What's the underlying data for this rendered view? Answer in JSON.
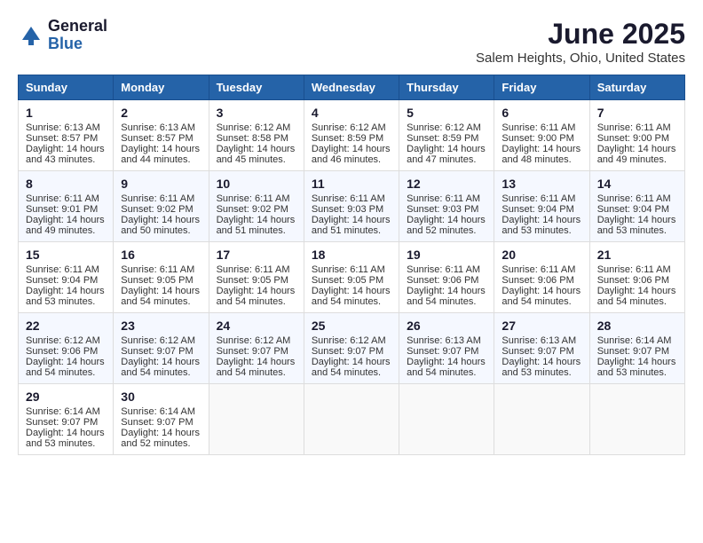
{
  "header": {
    "logo_general": "General",
    "logo_blue": "Blue",
    "month_title": "June 2025",
    "location": "Salem Heights, Ohio, United States"
  },
  "days_of_week": [
    "Sunday",
    "Monday",
    "Tuesday",
    "Wednesday",
    "Thursday",
    "Friday",
    "Saturday"
  ],
  "weeks": [
    [
      {
        "day": "1",
        "sunrise": "6:13 AM",
        "sunset": "8:57 PM",
        "daylight": "14 hours and 43 minutes."
      },
      {
        "day": "2",
        "sunrise": "6:13 AM",
        "sunset": "8:57 PM",
        "daylight": "14 hours and 44 minutes."
      },
      {
        "day": "3",
        "sunrise": "6:12 AM",
        "sunset": "8:58 PM",
        "daylight": "14 hours and 45 minutes."
      },
      {
        "day": "4",
        "sunrise": "6:12 AM",
        "sunset": "8:59 PM",
        "daylight": "14 hours and 46 minutes."
      },
      {
        "day": "5",
        "sunrise": "6:12 AM",
        "sunset": "8:59 PM",
        "daylight": "14 hours and 47 minutes."
      },
      {
        "day": "6",
        "sunrise": "6:11 AM",
        "sunset": "9:00 PM",
        "daylight": "14 hours and 48 minutes."
      },
      {
        "day": "7",
        "sunrise": "6:11 AM",
        "sunset": "9:00 PM",
        "daylight": "14 hours and 49 minutes."
      }
    ],
    [
      {
        "day": "8",
        "sunrise": "6:11 AM",
        "sunset": "9:01 PM",
        "daylight": "14 hours and 49 minutes."
      },
      {
        "day": "9",
        "sunrise": "6:11 AM",
        "sunset": "9:02 PM",
        "daylight": "14 hours and 50 minutes."
      },
      {
        "day": "10",
        "sunrise": "6:11 AM",
        "sunset": "9:02 PM",
        "daylight": "14 hours and 51 minutes."
      },
      {
        "day": "11",
        "sunrise": "6:11 AM",
        "sunset": "9:03 PM",
        "daylight": "14 hours and 51 minutes."
      },
      {
        "day": "12",
        "sunrise": "6:11 AM",
        "sunset": "9:03 PM",
        "daylight": "14 hours and 52 minutes."
      },
      {
        "day": "13",
        "sunrise": "6:11 AM",
        "sunset": "9:04 PM",
        "daylight": "14 hours and 53 minutes."
      },
      {
        "day": "14",
        "sunrise": "6:11 AM",
        "sunset": "9:04 PM",
        "daylight": "14 hours and 53 minutes."
      }
    ],
    [
      {
        "day": "15",
        "sunrise": "6:11 AM",
        "sunset": "9:04 PM",
        "daylight": "14 hours and 53 minutes."
      },
      {
        "day": "16",
        "sunrise": "6:11 AM",
        "sunset": "9:05 PM",
        "daylight": "14 hours and 54 minutes."
      },
      {
        "day": "17",
        "sunrise": "6:11 AM",
        "sunset": "9:05 PM",
        "daylight": "14 hours and 54 minutes."
      },
      {
        "day": "18",
        "sunrise": "6:11 AM",
        "sunset": "9:05 PM",
        "daylight": "14 hours and 54 minutes."
      },
      {
        "day": "19",
        "sunrise": "6:11 AM",
        "sunset": "9:06 PM",
        "daylight": "14 hours and 54 minutes."
      },
      {
        "day": "20",
        "sunrise": "6:11 AM",
        "sunset": "9:06 PM",
        "daylight": "14 hours and 54 minutes."
      },
      {
        "day": "21",
        "sunrise": "6:11 AM",
        "sunset": "9:06 PM",
        "daylight": "14 hours and 54 minutes."
      }
    ],
    [
      {
        "day": "22",
        "sunrise": "6:12 AM",
        "sunset": "9:06 PM",
        "daylight": "14 hours and 54 minutes."
      },
      {
        "day": "23",
        "sunrise": "6:12 AM",
        "sunset": "9:07 PM",
        "daylight": "14 hours and 54 minutes."
      },
      {
        "day": "24",
        "sunrise": "6:12 AM",
        "sunset": "9:07 PM",
        "daylight": "14 hours and 54 minutes."
      },
      {
        "day": "25",
        "sunrise": "6:12 AM",
        "sunset": "9:07 PM",
        "daylight": "14 hours and 54 minutes."
      },
      {
        "day": "26",
        "sunrise": "6:13 AM",
        "sunset": "9:07 PM",
        "daylight": "14 hours and 54 minutes."
      },
      {
        "day": "27",
        "sunrise": "6:13 AM",
        "sunset": "9:07 PM",
        "daylight": "14 hours and 53 minutes."
      },
      {
        "day": "28",
        "sunrise": "6:14 AM",
        "sunset": "9:07 PM",
        "daylight": "14 hours and 53 minutes."
      }
    ],
    [
      {
        "day": "29",
        "sunrise": "6:14 AM",
        "sunset": "9:07 PM",
        "daylight": "14 hours and 53 minutes."
      },
      {
        "day": "30",
        "sunrise": "6:14 AM",
        "sunset": "9:07 PM",
        "daylight": "14 hours and 52 minutes."
      },
      null,
      null,
      null,
      null,
      null
    ]
  ],
  "labels": {
    "sunrise": "Sunrise:",
    "sunset": "Sunset:",
    "daylight": "Daylight:"
  }
}
